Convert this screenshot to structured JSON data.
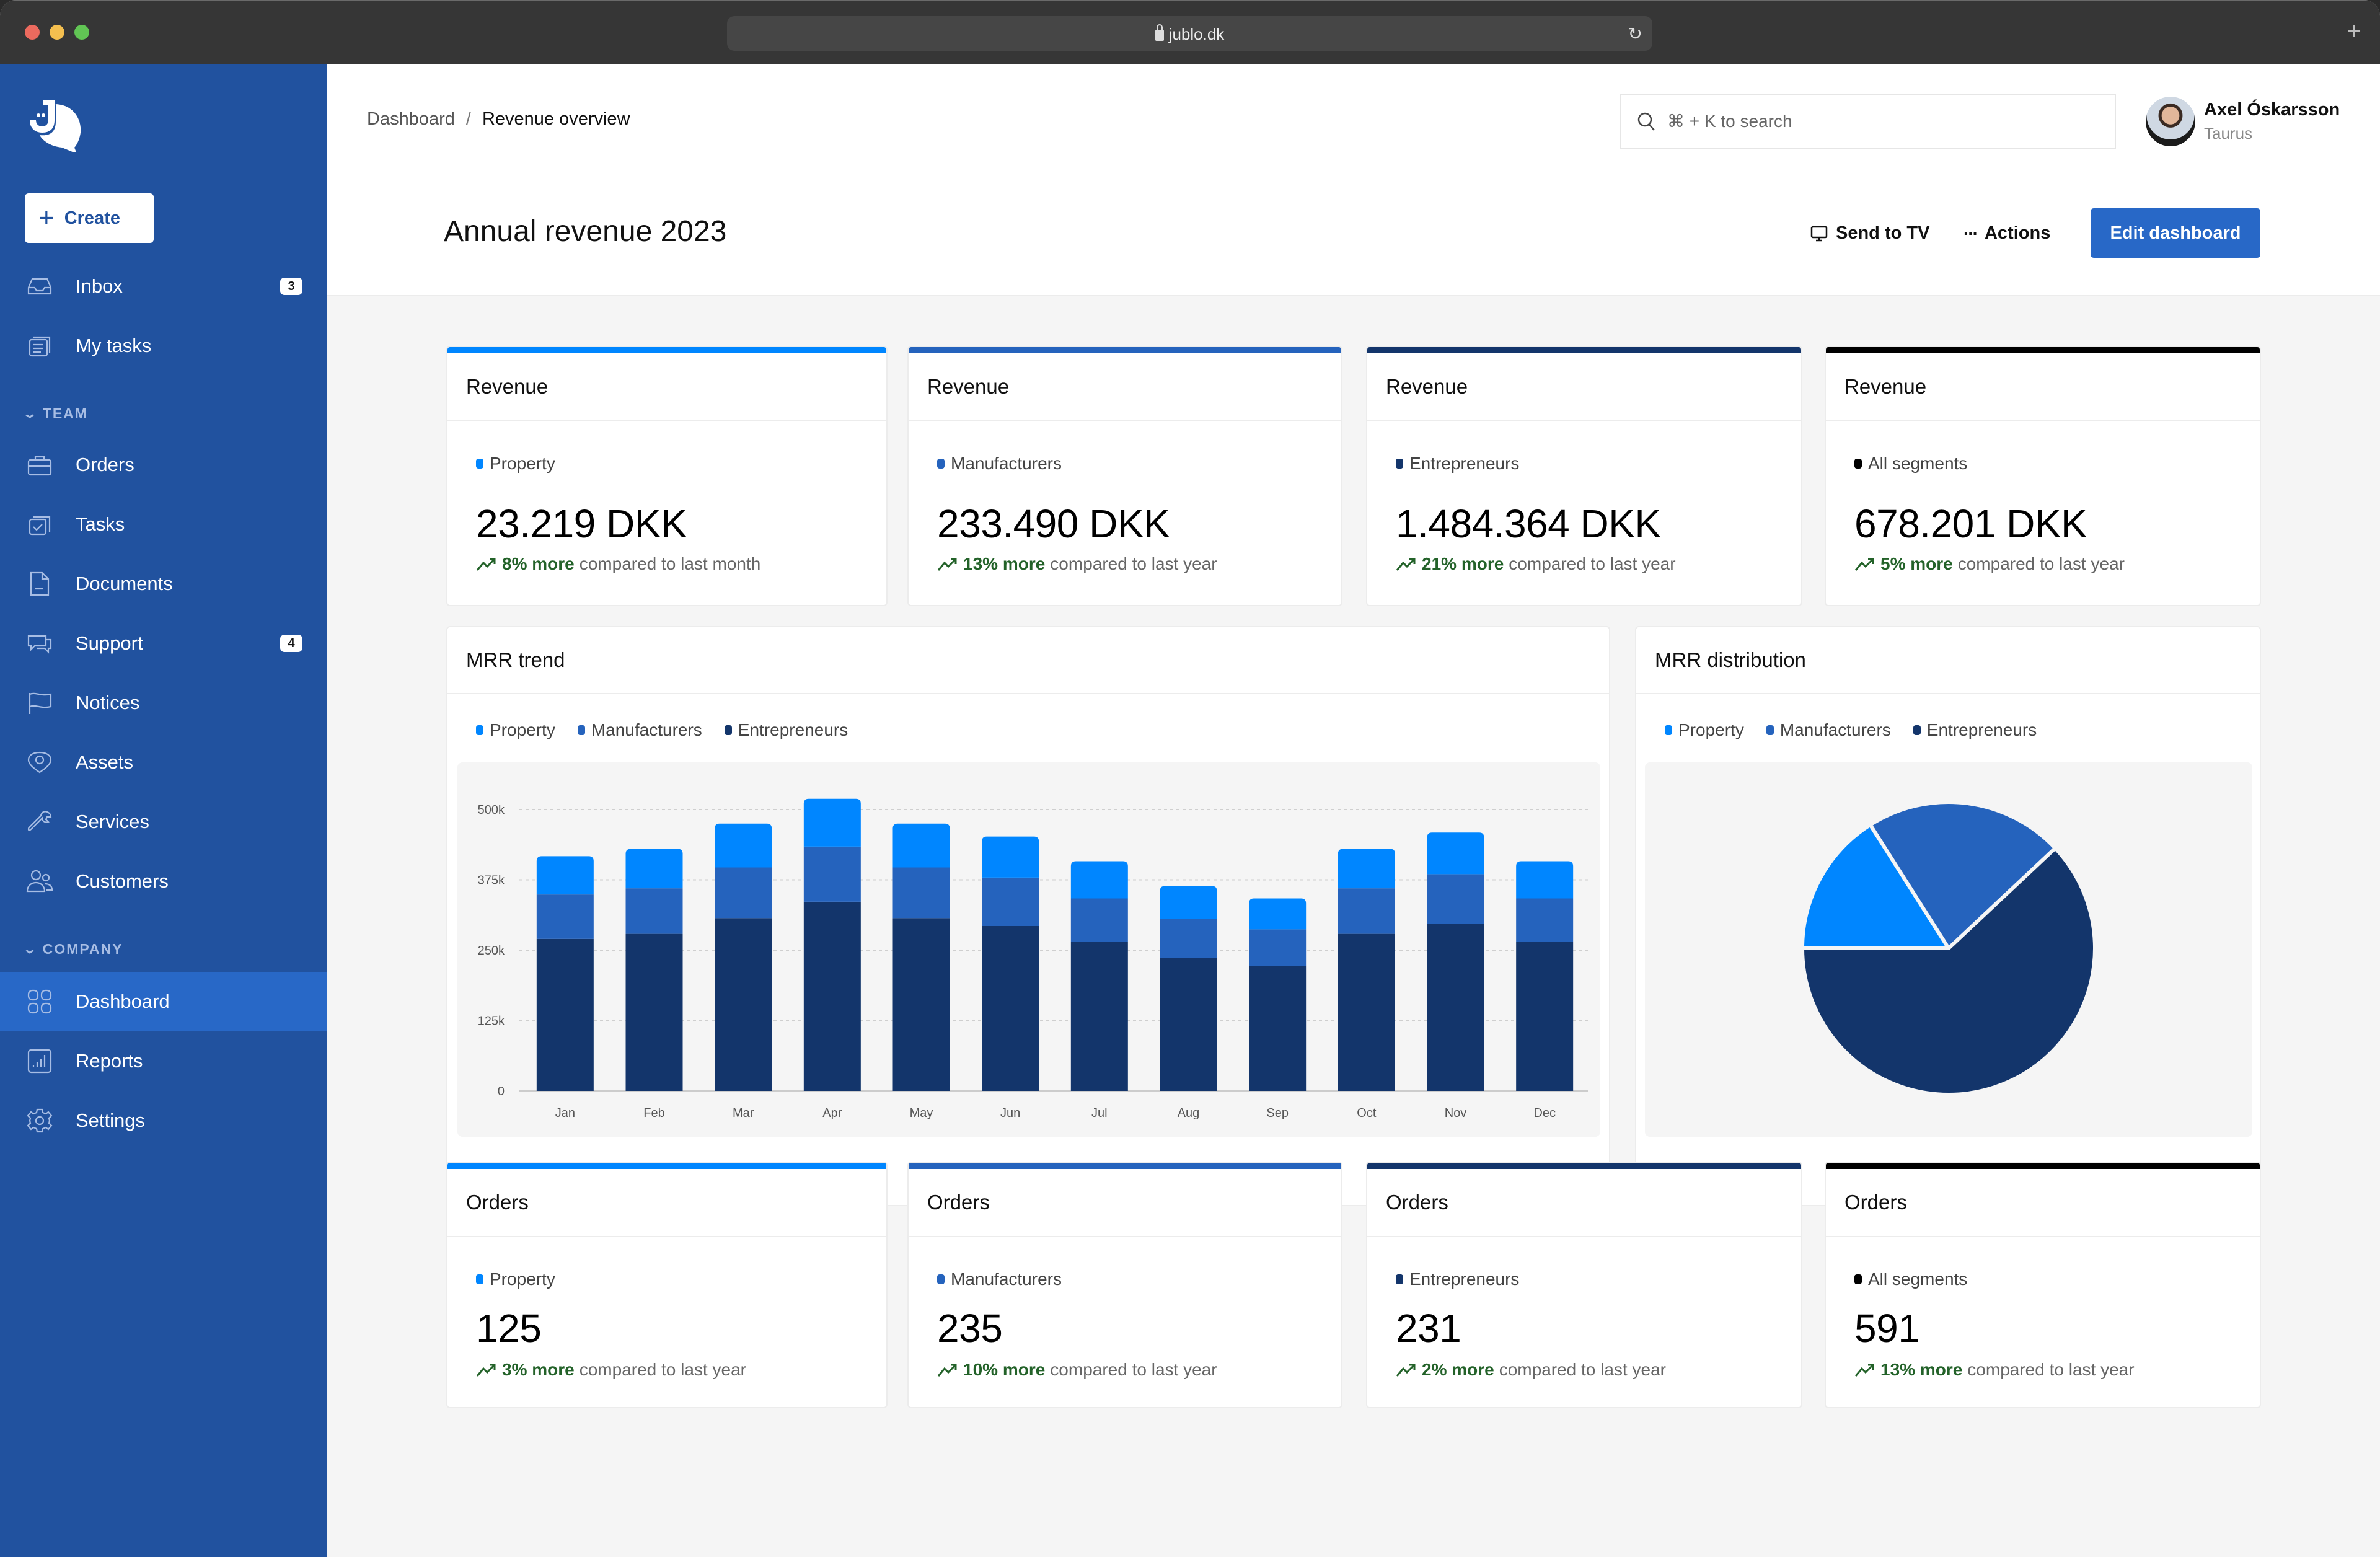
{
  "browser": {
    "url": "jublo.dk",
    "lock_icon": "lock-icon",
    "reload_icon": "reload-icon",
    "new_tab_icon": "plus-icon"
  },
  "colors": {
    "sidebar_bg": "#21529f",
    "accent": "#2868c7",
    "property": "#0086ff",
    "manufacturers": "#2563bd",
    "entrepreneurs": "#13356b",
    "all_segments": "#000000",
    "positive": "#236229"
  },
  "sidebar": {
    "create_label": "Create",
    "items_top": [
      {
        "label": "Inbox",
        "icon": "inbox-icon",
        "badge": "3"
      },
      {
        "label": "My tasks",
        "icon": "clipboard-list-icon"
      }
    ],
    "team_label": "TEAM",
    "team_items": [
      {
        "label": "Orders",
        "icon": "briefcase-icon"
      },
      {
        "label": "Tasks",
        "icon": "clipboard-check-icon"
      },
      {
        "label": "Documents",
        "icon": "document-icon"
      },
      {
        "label": "Support",
        "icon": "chat-bubbles-icon",
        "badge": "4"
      },
      {
        "label": "Notices",
        "icon": "flag-icon"
      },
      {
        "label": "Assets",
        "icon": "location-pin-icon"
      },
      {
        "label": "Services",
        "icon": "wrench-icon"
      },
      {
        "label": "Customers",
        "icon": "users-icon"
      }
    ],
    "company_label": "COMPANY",
    "company_items": [
      {
        "label": "Dashboard",
        "icon": "grid-icon",
        "active": true
      },
      {
        "label": "Reports",
        "icon": "bar-chart-icon"
      },
      {
        "label": "Settings",
        "icon": "gear-icon"
      }
    ]
  },
  "header": {
    "breadcrumb": [
      "Dashboard",
      "Revenue overview"
    ],
    "search_placeholder": "⌘ + K to search",
    "user_name": "Axel Óskarsson",
    "user_sub": "Taurus",
    "page_title": "Annual revenue 2023",
    "send_to_tv_label": "Send to TV",
    "actions_label": "Actions",
    "edit_label": "Edit dashboard"
  },
  "revenue_cards": [
    {
      "title": "Revenue",
      "segment": "Property",
      "value": "23.219 DKK",
      "delta_pct": "8% more",
      "delta_text": "compared to last month",
      "color_key": "property"
    },
    {
      "title": "Revenue",
      "segment": "Manufacturers",
      "value": "233.490 DKK",
      "delta_pct": "13% more",
      "delta_text": "compared to last year",
      "color_key": "manufacturers"
    },
    {
      "title": "Revenue",
      "segment": "Entrepreneurs",
      "value": "1.484.364 DKK",
      "delta_pct": "21% more",
      "delta_text": "compared to last year",
      "color_key": "entrepreneurs"
    },
    {
      "title": "Revenue",
      "segment": "All segments",
      "value": "678.201 DKK",
      "delta_pct": "5% more",
      "delta_text": "compared to last year",
      "color_key": "all_segments"
    }
  ],
  "order_cards": [
    {
      "title": "Orders",
      "segment": "Property",
      "value": "125",
      "delta_pct": "3% more",
      "delta_text": "compared to last year",
      "color_key": "property"
    },
    {
      "title": "Orders",
      "segment": "Manufacturers",
      "value": "235",
      "delta_pct": "10% more",
      "delta_text": "compared to last year",
      "color_key": "manufacturers"
    },
    {
      "title": "Orders",
      "segment": "Entrepreneurs",
      "value": "231",
      "delta_pct": "2% more",
      "delta_text": "compared to last year",
      "color_key": "entrepreneurs"
    },
    {
      "title": "Orders",
      "segment": "All segments",
      "value": "591",
      "delta_pct": "13% more",
      "delta_text": "compared to last year",
      "color_key": "all_segments"
    }
  ],
  "chart_data": [
    {
      "type": "bar",
      "stacked": true,
      "title": "MRR trend",
      "xlabel": "",
      "ylabel": "",
      "categories": [
        "Jan",
        "Feb",
        "Mar",
        "Apr",
        "May",
        "Jun",
        "Jul",
        "Aug",
        "Sep",
        "Oct",
        "Nov",
        "Dec"
      ],
      "series": [
        {
          "name": "Entrepreneurs",
          "color_key": "entrepreneurs",
          "values": [
            270,
            279,
            307,
            336,
            307,
            293,
            265,
            236,
            222,
            279,
            297,
            265
          ]
        },
        {
          "name": "Manufacturers",
          "color_key": "manufacturers",
          "values": [
            79,
            81,
            90,
            98,
            90,
            86,
            77,
            69,
            65,
            81,
            88,
            77
          ]
        },
        {
          "name": "Property",
          "color_key": "property",
          "values": [
            68,
            70,
            78,
            85,
            78,
            73,
            66,
            59,
            55,
            70,
            74,
            66
          ]
        }
      ],
      "units": "thousands",
      "ylim": [
        0,
        500
      ],
      "yticks": [
        0,
        125,
        250,
        375,
        500
      ],
      "ytick_labels": [
        "0",
        "125k",
        "250k",
        "375k",
        "500k"
      ],
      "legend": [
        "Property",
        "Manufacturers",
        "Entrepreneurs"
      ],
      "legend_position": "top-left",
      "grid": true
    },
    {
      "type": "pie",
      "title": "MRR distribution",
      "labels": [
        "Property",
        "Manufacturers",
        "Entrepreneurs"
      ],
      "values": [
        16,
        22,
        62
      ],
      "units": "percent",
      "color_keys": [
        "property",
        "manufacturers",
        "entrepreneurs"
      ],
      "legend": [
        "Property",
        "Manufacturers",
        "Entrepreneurs"
      ],
      "legend_position": "top-left"
    }
  ]
}
